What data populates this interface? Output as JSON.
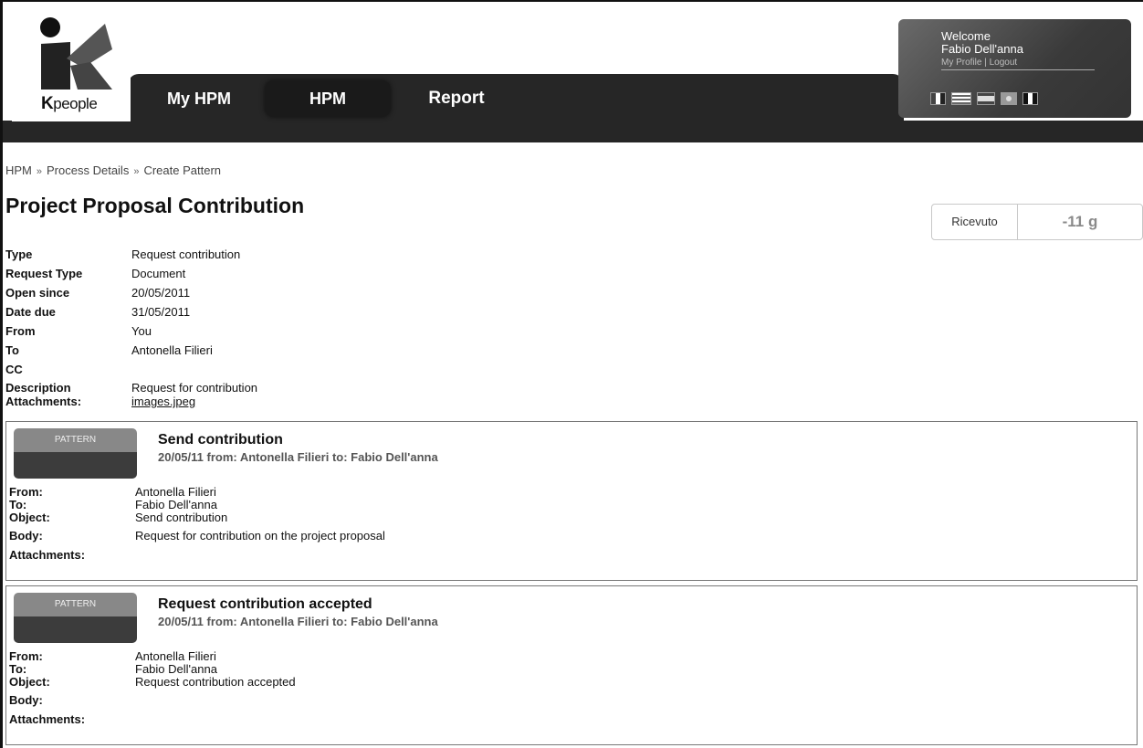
{
  "logo": {
    "brand_bold": "K",
    "brand_rest": "people"
  },
  "nav": {
    "tabs": [
      {
        "label": "My HPM"
      },
      {
        "label": "HPM"
      },
      {
        "label": "Report"
      }
    ]
  },
  "user": {
    "welcome": "Welcome",
    "name": "Fabio Dell'anna",
    "profile_link": "My Profile",
    "separator": " | ",
    "logout_link": "Logout"
  },
  "breadcrumb": {
    "items": [
      "HPM",
      "Process Details",
      "Create Pattern"
    ],
    "separator": "»"
  },
  "page": {
    "title": "Project Proposal Contribution",
    "status_label": "Ricevuto",
    "status_days": "-11 g"
  },
  "details": {
    "type_label": "Type",
    "type_value": "Request contribution",
    "request_type_label": "Request Type",
    "request_type_value": "Document",
    "open_since_label": "Open since",
    "open_since_value": "20/05/2011",
    "date_due_label": "Date due",
    "date_due_value": "31/05/2011",
    "from_label": "From",
    "from_value": "You",
    "to_label": "To",
    "to_value": "Antonella Filieri",
    "cc_label": "CC",
    "cc_value": "",
    "description_label": "Description",
    "description_value": "Request for contribution",
    "attachments_label": "Attachments:",
    "attachments_value": "images.jpeg"
  },
  "messages": [
    {
      "badge": "PATTERN",
      "title": "Send contribution",
      "subtitle": "20/05/11 from: Antonella Filieri to: Fabio Dell'anna",
      "from_label": "From:",
      "from": "Antonella Filieri",
      "to_label": "To:",
      "to": "Fabio Dell'anna",
      "object_label": "Object:",
      "object": "Send contribution",
      "body_label": "Body:",
      "body": "Request for contribution on the project proposal",
      "attachments_label": "Attachments:",
      "attachments": ""
    },
    {
      "badge": "PATTERN",
      "title": "Request contribution accepted",
      "subtitle": "20/05/11 from: Antonella Filieri to: Fabio Dell'anna",
      "from_label": "From:",
      "from": "Antonella Filieri",
      "to_label": "To:",
      "to": "Fabio Dell'anna",
      "object_label": "Object:",
      "object": "Request contribution accepted",
      "body_label": "Body:",
      "body": "",
      "attachments_label": "Attachments:",
      "attachments": ""
    }
  ],
  "colors": {
    "nav_background": "#262626",
    "badge_top": "#888888",
    "badge_bottom": "#3c3c3c"
  }
}
